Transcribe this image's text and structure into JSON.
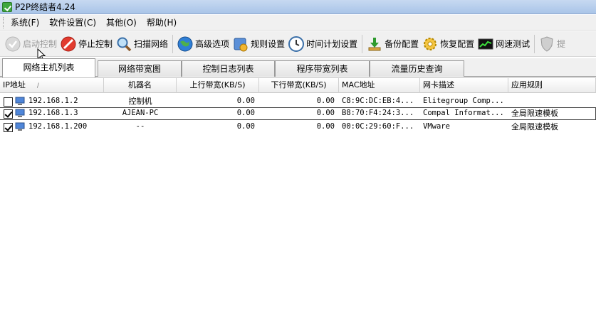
{
  "window": {
    "title": "P2P终结者4.24"
  },
  "menu": {
    "items": [
      {
        "label": "系统(F)"
      },
      {
        "label": "软件设置(C)"
      },
      {
        "label": "其他(O)"
      },
      {
        "label": "帮助(H)"
      }
    ]
  },
  "toolbar": {
    "start": "启动控制",
    "stop": "停止控制",
    "scan": "扫描网络",
    "advanced": "高级选项",
    "rules": "规则设置",
    "schedule": "时间计划设置",
    "backup": "备份配置",
    "restore": "恢复配置",
    "speedtest": "网速测试",
    "cut": "提"
  },
  "tabs": [
    {
      "label": "网络主机列表"
    },
    {
      "label": "网络带宽图"
    },
    {
      "label": "控制日志列表"
    },
    {
      "label": "程序带宽列表"
    },
    {
      "label": "流量历史查询"
    }
  ],
  "table": {
    "columns": [
      "IP地址",
      "机器名",
      "上行带宽(KB/S)",
      "下行带宽(KB/S)",
      "MAC地址",
      "网卡描述",
      "应用规则"
    ],
    "sort_indicator": "/",
    "rows": [
      {
        "checked": false,
        "ip": "192.168.1.2",
        "name": "控制机",
        "up": "0.00",
        "down": "0.00",
        "mac": "C8:9C:DC:EB:4...",
        "nic": "Elitegroup Comp...",
        "rule": ""
      },
      {
        "checked": true,
        "ip": "192.168.1.3",
        "name": "AJEAN-PC",
        "up": "0.00",
        "down": "0.00",
        "mac": "B8:70:F4:24:3...",
        "nic": "Compal Informat...",
        "rule": "全局限速模板"
      },
      {
        "checked": true,
        "ip": "192.168.1.200",
        "name": "--",
        "up": "0.00",
        "down": "0.00",
        "mac": "00:0C:29:60:F...",
        "nic": "VMware",
        "rule": "全局限速模板"
      }
    ]
  }
}
